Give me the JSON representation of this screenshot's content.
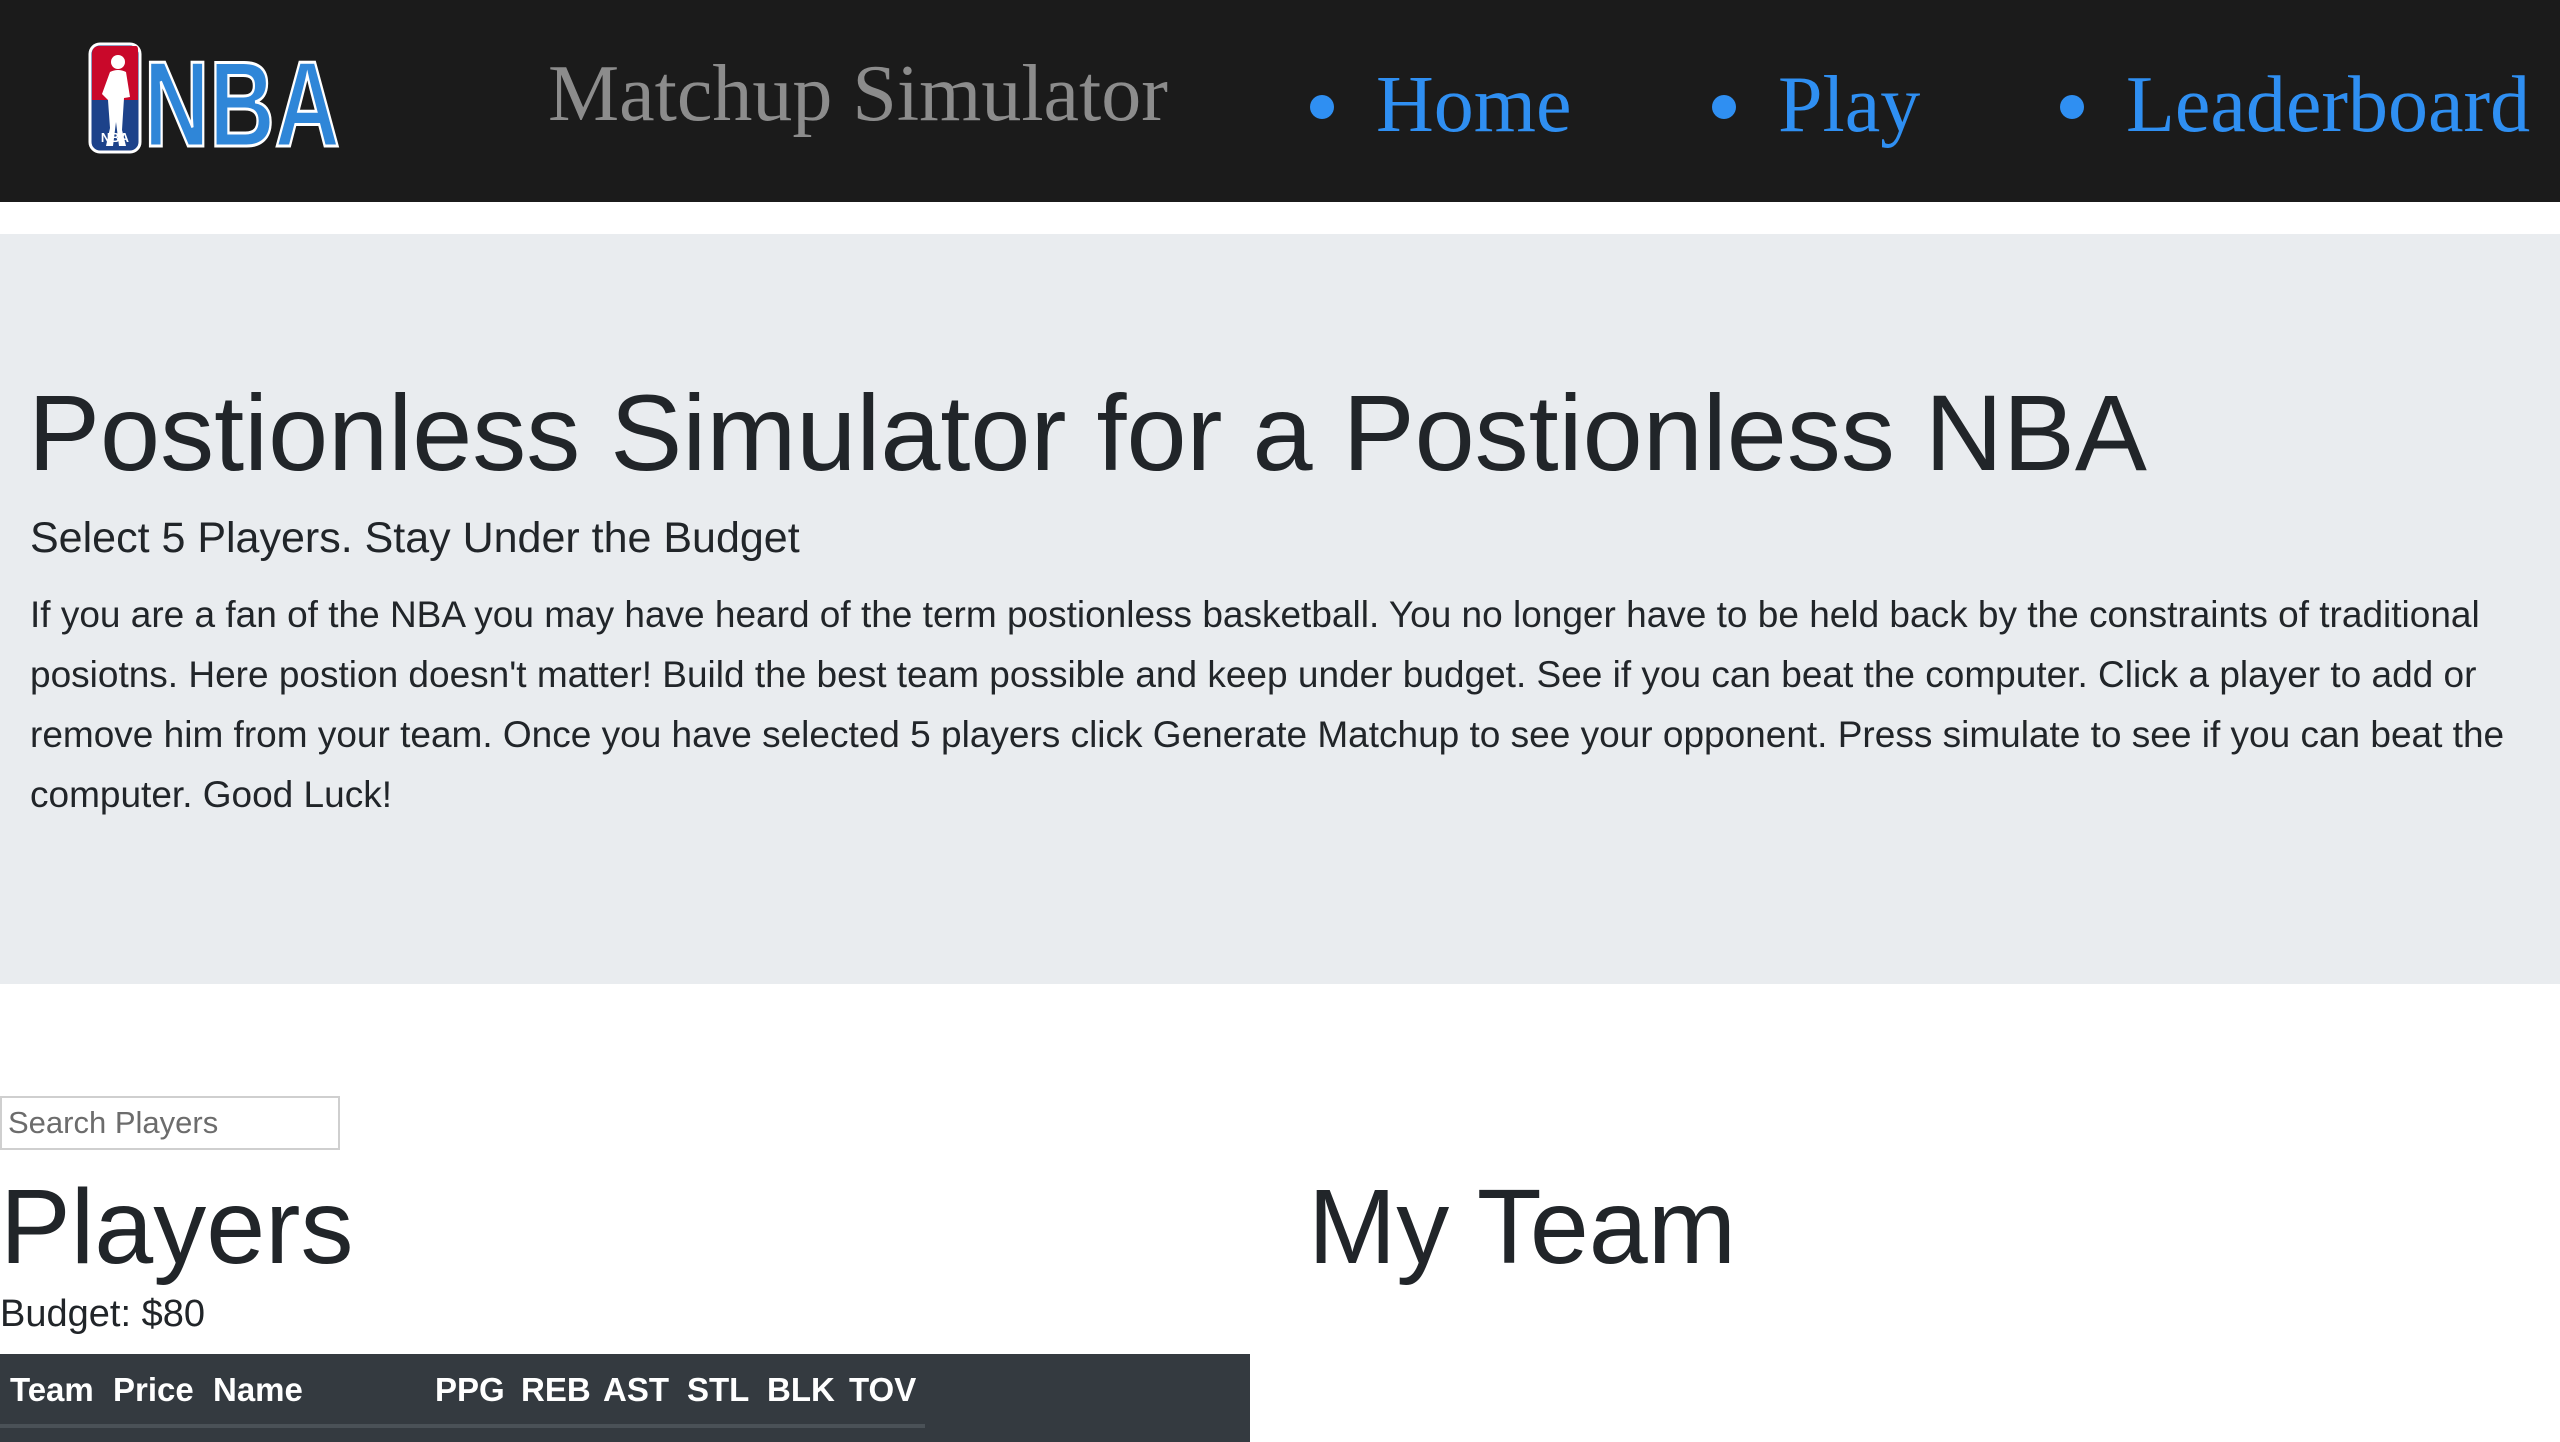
{
  "navbar": {
    "logo_text": "NBA",
    "brand": "Matchup Simulator",
    "links": [
      {
        "label": "Home"
      },
      {
        "label": "Play"
      },
      {
        "label": "Leaderboard"
      }
    ],
    "colors": {
      "background": "#1b1b1b",
      "link": "#2f8ff2",
      "brand": "#8c8c8c"
    }
  },
  "hero": {
    "title": "Postionless Simulator for a Postionless NBA",
    "subtitle": "Select 5 Players. Stay Under the Budget",
    "description": "If you are a fan of the NBA you may have heard of the term postionless basketball. You no longer have to be held back by the constraints of traditional posiotns. Here postion doesn't matter! Build the best team possible and keep under budget. See if you can beat the computer. Click a player to add or remove him from your team. Once you have selected 5 players click Generate Matchup to see your opponent. Press simulate to see if you can beat the computer. Good Luck!",
    "background": "#e9ecef"
  },
  "search": {
    "placeholder": "Search Players",
    "value": ""
  },
  "players": {
    "heading": "Players",
    "budget_label": "Budget:",
    "budget_value": "$80",
    "columns": [
      "Team",
      "Price",
      "Name",
      "PPG",
      "REB",
      "AST",
      "STL",
      "BLK",
      "TOV"
    ],
    "header_background": "#343a40"
  },
  "my_team": {
    "heading": "My Team"
  }
}
